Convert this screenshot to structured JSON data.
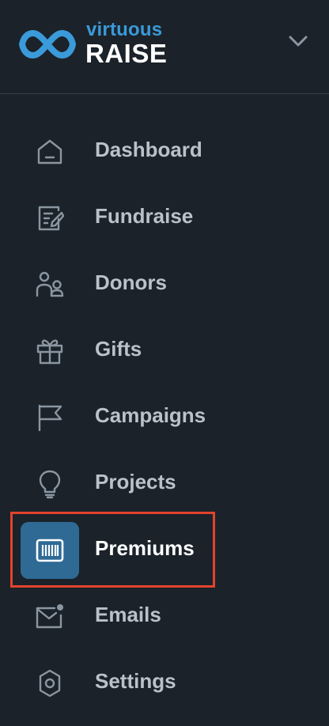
{
  "brand": {
    "top": "virtuous",
    "main": "RAISE"
  },
  "colors": {
    "background": "#1b2229",
    "accent": "#3b9ad9",
    "active_bg": "#2f6a95",
    "highlight": "#e2432d",
    "label": "#b9c2cb"
  },
  "nav": {
    "items": [
      {
        "label": "Dashboard",
        "icon": "home-icon"
      },
      {
        "label": "Fundraise",
        "icon": "edit-form-icon"
      },
      {
        "label": "Donors",
        "icon": "people-icon"
      },
      {
        "label": "Gifts",
        "icon": "gift-icon"
      },
      {
        "label": "Campaigns",
        "icon": "flag-icon"
      },
      {
        "label": "Projects",
        "icon": "lightbulb-icon"
      },
      {
        "label": "Premiums",
        "icon": "barcode-icon",
        "active": true
      },
      {
        "label": "Emails",
        "icon": "mail-notification-icon"
      },
      {
        "label": "Settings",
        "icon": "gear-icon"
      }
    ]
  }
}
